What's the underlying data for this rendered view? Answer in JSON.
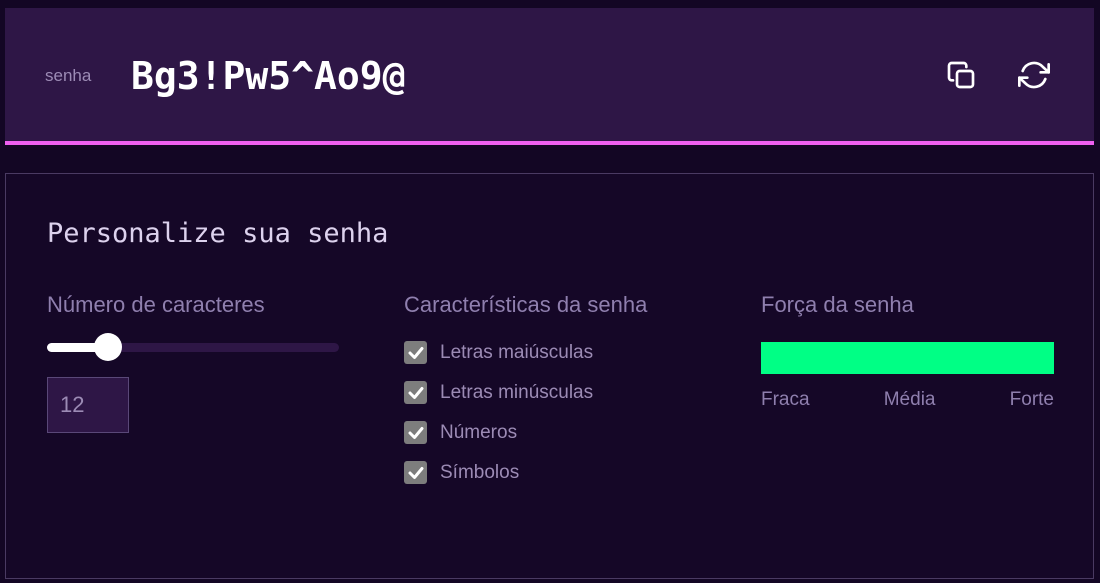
{
  "header": {
    "label": "senha",
    "password": "Bg3!Pw5^Ao9@",
    "copy_icon": "copy-icon",
    "refresh_icon": "refresh-icon"
  },
  "panel": {
    "title": "Personalize sua senha",
    "length_section": {
      "title": "Número de caracteres",
      "value": "12",
      "slider_fraction": 0.21
    },
    "characteristics_section": {
      "title": "Características da senha",
      "options": [
        {
          "label": "Letras maiúsculas",
          "checked": true
        },
        {
          "label": "Letras minúsculas",
          "checked": true
        },
        {
          "label": "Números",
          "checked": true
        },
        {
          "label": "Símbolos",
          "checked": true
        }
      ]
    },
    "strength_section": {
      "title": "Força da senha",
      "level_fraction": 1.0,
      "labels": [
        "Fraca",
        "Média",
        "Forte"
      ]
    }
  },
  "colors": {
    "background": "#130624",
    "header_bg": "#2e1646",
    "accent_line": "#ef5ff0",
    "strength_strong": "#00ff85",
    "muted_text": "#9c8bb5"
  }
}
